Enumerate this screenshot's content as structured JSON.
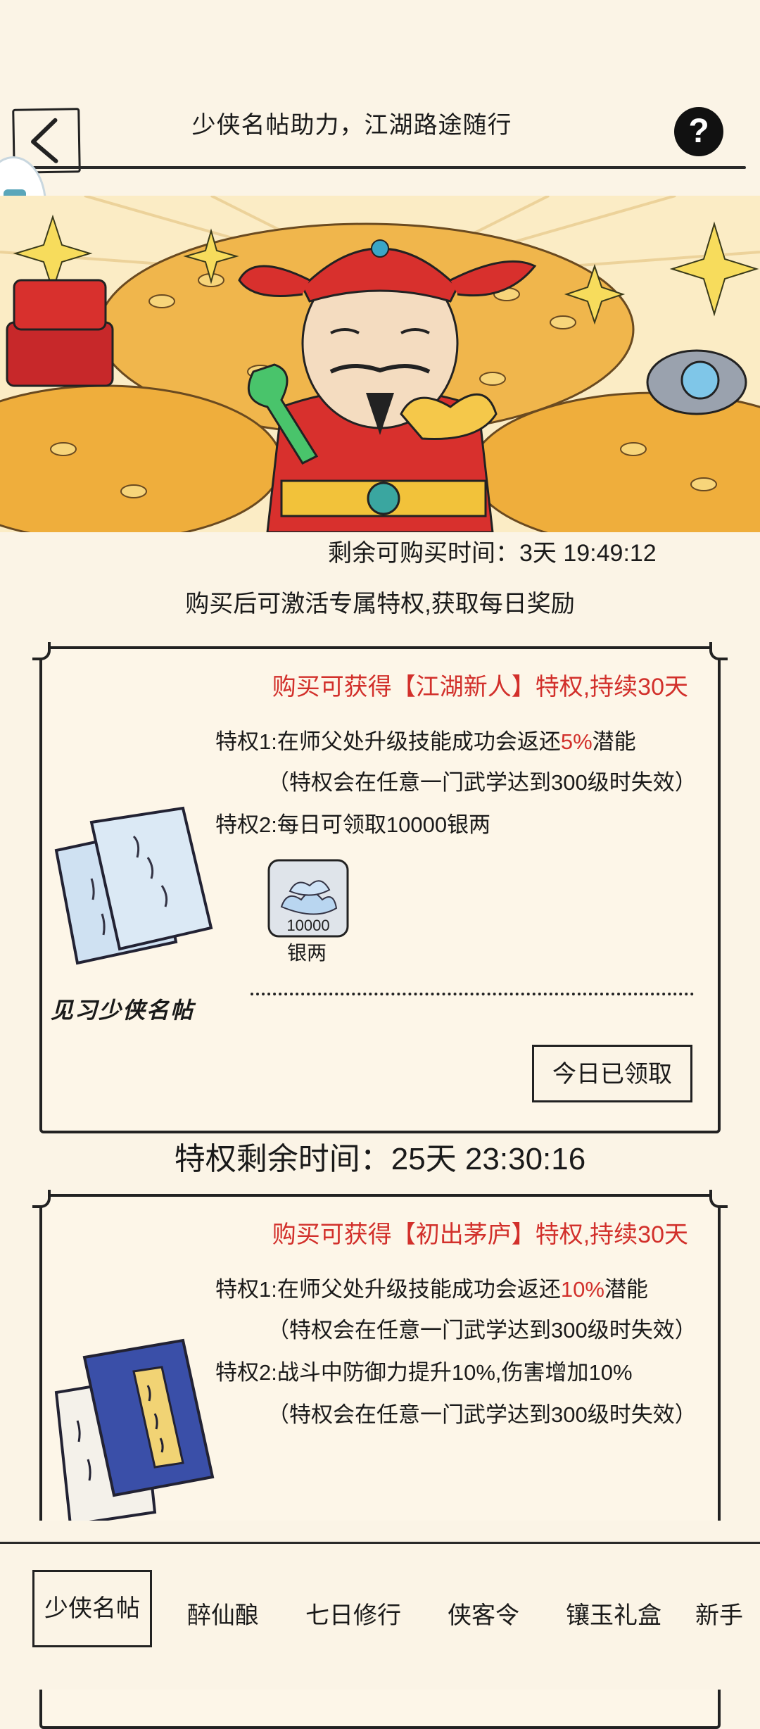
{
  "header": {
    "title": "少侠名帖助力，江湖路途随行",
    "help_symbol": "?"
  },
  "banner": {
    "remaining_label": "剩余可购买时间：",
    "remaining_value": "3天 19:49:12",
    "subtitle": "购买后可激活专属特权,获取每日奖励"
  },
  "card1": {
    "heading": "购买可获得【江湖新人】特权,持续30天",
    "priv1_prefix": "特权1:在师父处升级技能成功会返还",
    "priv1_pct": "5%",
    "priv1_suffix": "潜能",
    "priv1_note": "（特权会在任意一门武学达到300级时失效）",
    "priv2": "特权2:每日可领取10000银两",
    "reward_amount": "10000",
    "reward_name": "银两",
    "item_name": "见习少侠名帖",
    "claim_button": "今日已领取",
    "remaining": "特权剩余时间：25天 23:30:16"
  },
  "card2": {
    "heading": "购买可获得【初出茅庐】特权,持续30天",
    "priv1_prefix": "特权1:在师父处升级技能成功会返还",
    "priv1_pct": "10%",
    "priv1_suffix": "潜能",
    "priv1_note": "（特权会在任意一门武学达到300级时失效）",
    "priv2": "特权2:战斗中防御力提升10%,伤害增加10%",
    "priv2_note": "（特权会在任意一门武学达到300级时失效）"
  },
  "tabs": [
    {
      "label": "少侠名帖",
      "active": true
    },
    {
      "label": "醉仙酿",
      "active": false
    },
    {
      "label": "七日修行",
      "active": false
    },
    {
      "label": "侠客令",
      "active": false
    },
    {
      "label": "镶玉礼盒",
      "active": false
    },
    {
      "label": "新手",
      "active": false
    }
  ],
  "colors": {
    "background": "#fbf4e6",
    "accent_red": "#d2302b",
    "ink": "#222222"
  }
}
